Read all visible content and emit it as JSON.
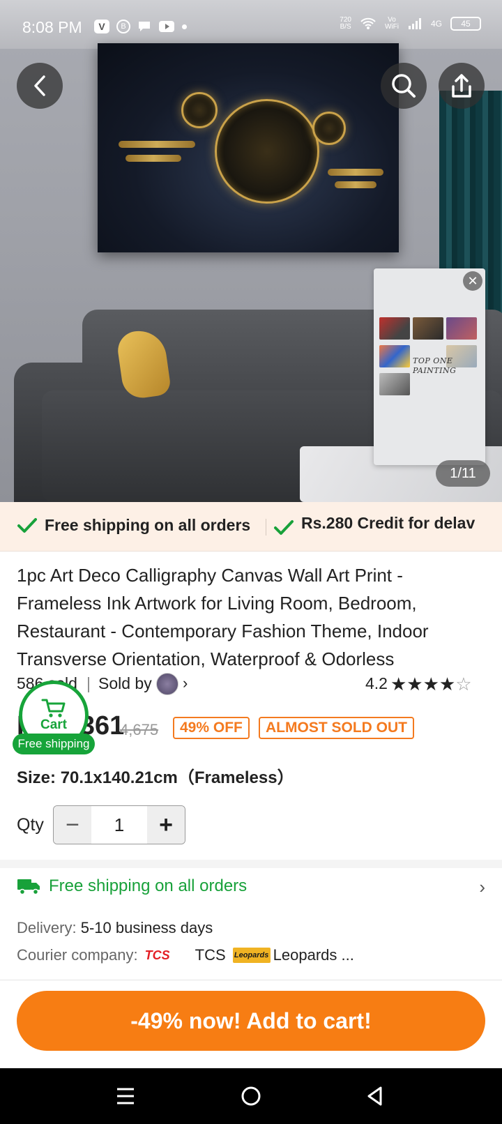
{
  "status_bar": {
    "time": "8:08 PM",
    "net_speed": "720",
    "net_unit": "B/S",
    "volte": "Vo",
    "wifi_label": "WiFi",
    "lte_label": "4G",
    "battery": "45"
  },
  "gallery": {
    "page_counter": "1/11",
    "mini_video": {
      "brand_line1": "TOP ONE",
      "brand_line2": "PAINTING"
    }
  },
  "promo_strip": {
    "item1": "Free shipping on all orders",
    "item2": "Rs.280 Credit for delav"
  },
  "product": {
    "title": "1pc Art Deco Calligraphy Canvas Wall Art Print - Frameless Ink Artwork for Living Room, Bedroom, Restaurant - Contemporary Fashion Theme, Indoor Transverse Orientation, Waterproof & Odorless",
    "sold_count": "586 sold",
    "sold_by_label": "Sold by",
    "rating": "4.2",
    "price_current": "Rs.2,361",
    "price_original": "4,675",
    "discount_tag": "49% OFF",
    "stock_tag": "ALMOST SOLD OUT",
    "size_label": "Size:",
    "size_value": "70.1x140.21cm（Frameless）",
    "qty_label": "Qty",
    "qty_value": "1"
  },
  "floating_cart": {
    "label": "Cart",
    "badge": "Free shipping"
  },
  "shipping": {
    "title": "Free shipping on all orders",
    "delivery_label": "Delivery:",
    "delivery_value": "5-10 business days",
    "courier_label": "Courier company:",
    "courier_1_logo": "TCS",
    "courier_1": "TCS",
    "courier_2_logo": "Leopards",
    "courier_2": "Leopards ..."
  },
  "cta": {
    "add_to_cart": "-49% now! Add to cart!"
  },
  "colors": {
    "accent_orange": "#f77d13",
    "success_green": "#18a13a",
    "promo_bg": "#fdf0e6"
  }
}
